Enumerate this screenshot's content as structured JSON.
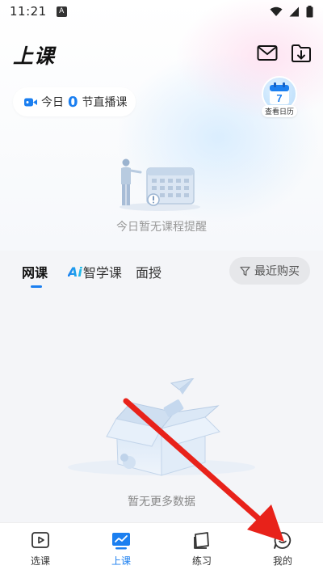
{
  "status_bar": {
    "time": "11:21",
    "notif_badge": "A"
  },
  "header": {
    "title": "上课"
  },
  "live": {
    "prefix": "今日",
    "count": "0",
    "suffix": "节直播课"
  },
  "calendar": {
    "day": "7",
    "label": "查看日历"
  },
  "empty_schedule": {
    "text": "今日暂无课程提醒"
  },
  "tabs": [
    {
      "label": "网课"
    },
    {
      "ai_mark": "Ai",
      "label": "智学课"
    },
    {
      "label": "面授"
    }
  ],
  "recent": {
    "label": "最近购买"
  },
  "empty_list": {
    "text": "暂无更多数据"
  },
  "bottom_nav": [
    {
      "label": "选课"
    },
    {
      "label": "上课"
    },
    {
      "label": "练习"
    },
    {
      "label": "我的"
    }
  ],
  "colors": {
    "accent": "#1b7ff0",
    "annotation_arrow": "#e8221a"
  }
}
